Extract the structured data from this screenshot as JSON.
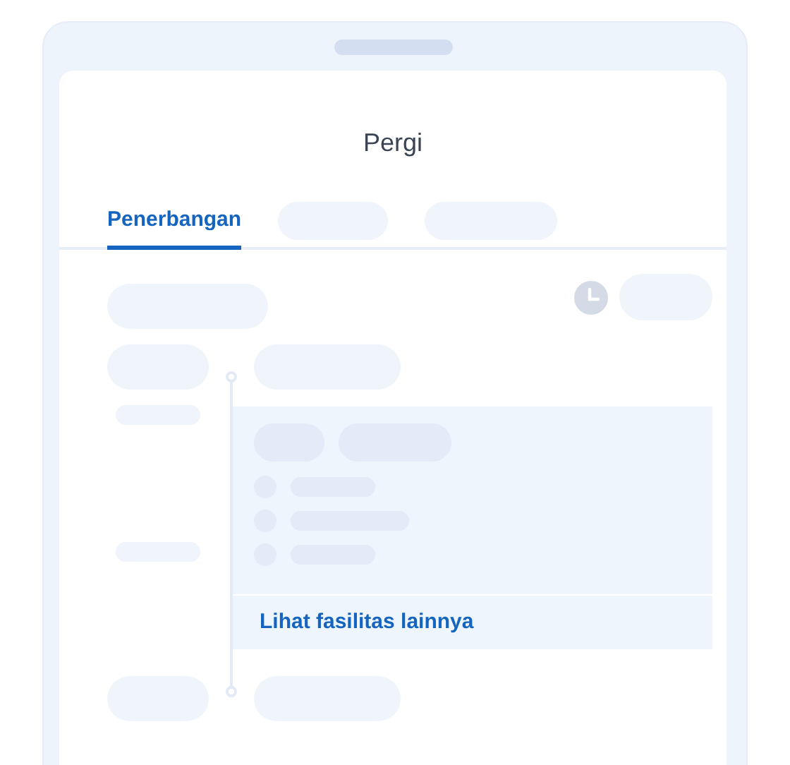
{
  "header": {
    "title": "Pergi"
  },
  "tabs": [
    {
      "label": "Penerbangan",
      "selected": true
    }
  ],
  "facilities_link": {
    "label": "Lihat fasilitas lainnya"
  }
}
